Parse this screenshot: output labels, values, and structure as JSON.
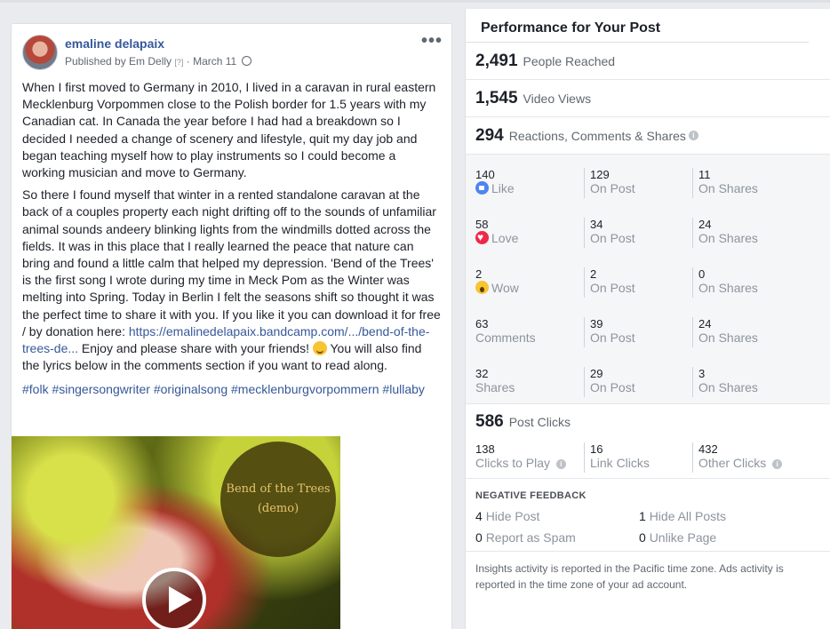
{
  "post": {
    "author": "emaline delapaix",
    "published_by": "Published by Em Delly",
    "help_marker": "[?]",
    "separator": " · ",
    "date": "March 11",
    "more_icon": "more-horizontal-icon",
    "paragraph1": "When I first moved to Germany in 2010, I lived in a caravan in rural eastern Mecklenburg Vorpommen close to the Polish border for 1.5 years with my Canadian cat. In Canada the year before I had had a breakdown so I decided I needed a change of scenery and lifestyle, quit my day job and began teaching myself how to play instruments so I could become a working musician and move to Germany.",
    "paragraph2_text": "So there I found myself that winter in a rented standalone caravan at the back of a couples property each night drifting off to the sounds of unfamiliar animal sounds andeery blinking lights from the windmills dotted across the fields. It was in this place that I really learned the peace that nature can bring and found a little calm that helped my depression. 'Bend of the Trees' is the first song I wrote during my time in Meck Pom as the Winter was melting into Spring. Today in Berlin I felt the seasons shift so thought it was the perfect time to share it with you. If you like it you can download it for free / by donation here:",
    "paragraph2_link": "https://emalinedelapaix.bandcamp.com/.../bend-of-the-trees-de...",
    "paragraph2_after_link": " Enjoy and please share with your friends! ",
    "paragraph2_end": " You will also find the lyrics below in the comments section if you want to read along.",
    "hashtags": "#folk #singersongwriter #originalsong #mecklenburgvorpommern #lullaby",
    "album_title": "Bend of the Trees",
    "album_subtitle": "(demo)"
  },
  "insights": {
    "title": "Performance for Your Post",
    "people_reached": {
      "value": "2,491",
      "label": "People Reached"
    },
    "video_views": {
      "value": "1,545",
      "label": "Video Views"
    },
    "engagement": {
      "value": "294",
      "label": "Reactions, Comments & Shares"
    },
    "reactions": [
      {
        "total": "140",
        "label": "Like",
        "icon": "like-icon",
        "on_post": "129",
        "on_shares": "11"
      },
      {
        "total": "58",
        "label": "Love",
        "icon": "love-icon",
        "on_post": "34",
        "on_shares": "24"
      },
      {
        "total": "2",
        "label": "Wow",
        "icon": "wow-icon",
        "on_post": "2",
        "on_shares": "0"
      },
      {
        "total": "63",
        "label": "Comments",
        "icon": "",
        "on_post": "39",
        "on_shares": "24"
      },
      {
        "total": "32",
        "label": "Shares",
        "icon": "",
        "on_post": "29",
        "on_shares": "3"
      }
    ],
    "on_post_label": "On Post",
    "on_shares_label": "On Shares",
    "post_clicks": {
      "value": "586",
      "label": "Post Clicks"
    },
    "clicks": [
      {
        "value": "138",
        "label": "Clicks to Play"
      },
      {
        "value": "16",
        "label": "Link Clicks"
      },
      {
        "value": "432",
        "label": "Other Clicks"
      }
    ],
    "negative": {
      "title": "NEGATIVE FEEDBACK",
      "hide_post": {
        "value": "4",
        "label": "Hide Post"
      },
      "hide_all": {
        "value": "1",
        "label": "Hide All Posts"
      },
      "spam": {
        "value": "0",
        "label": "Report as Spam"
      },
      "unlike": {
        "value": "0",
        "label": "Unlike Page"
      }
    },
    "footnote": "Insights activity is reported in the Pacific time zone. Ads activity is reported in the time zone of your ad account."
  }
}
